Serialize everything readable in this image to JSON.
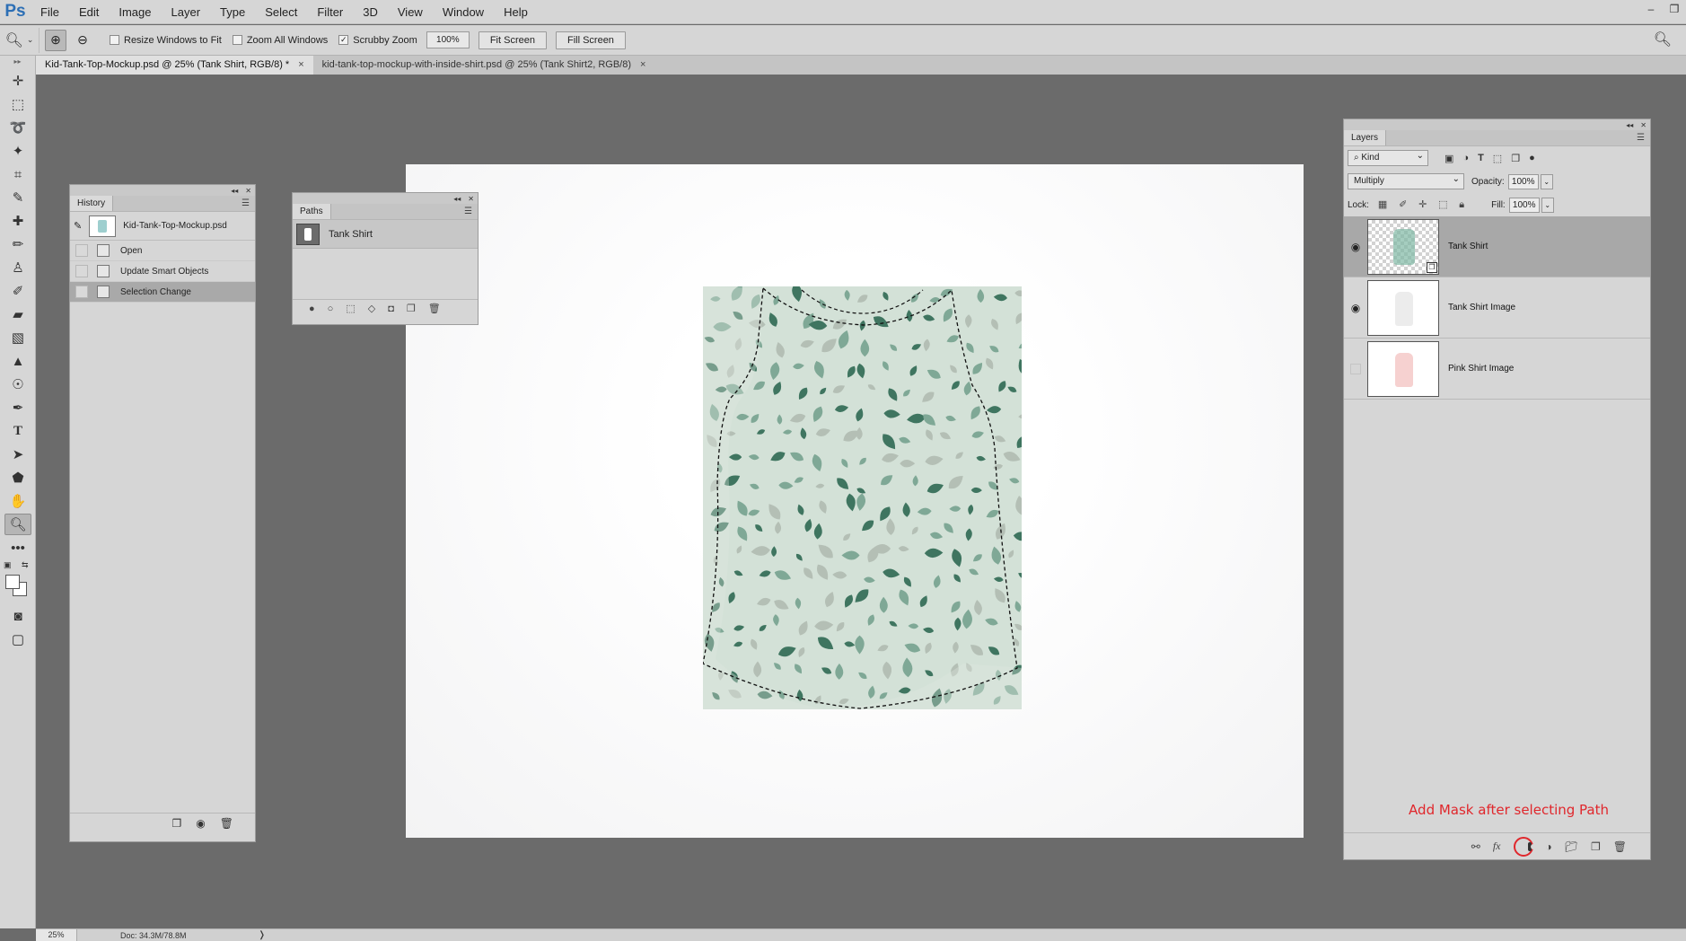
{
  "app": {
    "logo": "Ps",
    "window_controls": [
      "–",
      "❐"
    ]
  },
  "menu": [
    "File",
    "Edit",
    "Image",
    "Layer",
    "Type",
    "Select",
    "Filter",
    "3D",
    "View",
    "Window",
    "Help"
  ],
  "options": {
    "tool_icon": "zoom-tool-icon",
    "resize_windows": "Resize Windows to Fit",
    "zoom_all": "Zoom All Windows",
    "scrubby": "Scrubby Zoom",
    "scrubby_checked": "✓",
    "zoom_value": "100%",
    "fit_screen": "Fit Screen",
    "fill_screen": "Fill Screen"
  },
  "tabs": [
    {
      "label": "Kid-Tank-Top-Mockup.psd @ 25% (Tank Shirt, RGB/8) *",
      "close": "×"
    },
    {
      "label": "kid-tank-top-mockup-with-inside-shirt.psd @ 25% (Tank Shirt2, RGB/8)",
      "close": "×"
    }
  ],
  "history": {
    "title": "History",
    "snapshot": "Kid-Tank-Top-Mockup.psd",
    "items": [
      "Open",
      "Update Smart Objects",
      "Selection Change"
    ],
    "selected_index": 2
  },
  "paths": {
    "title": "Paths",
    "items": [
      "Tank Shirt"
    ]
  },
  "layers": {
    "title": "Layers",
    "kind": "Kind",
    "blend_mode": "Multiply",
    "opacity_label": "Opacity:",
    "opacity": "100%",
    "lock_label": "Lock:",
    "fill_label": "Fill:",
    "fill": "100%",
    "items": [
      {
        "name": "Tank Shirt",
        "visible": true,
        "selected": true
      },
      {
        "name": "Tank Shirt Image",
        "visible": true,
        "selected": false
      },
      {
        "name": "Pink Shirt Image",
        "visible": false,
        "selected": false
      }
    ],
    "annotation": "Add Mask after selecting Path"
  },
  "status": {
    "zoom": "25%",
    "doc": "Doc: 34.3M/78.8M",
    "arrow": "❭"
  },
  "colors": {
    "accent_red": "#e0272c",
    "shirt_base": "#d3e1d7",
    "leaf_dark": "#3f7560",
    "leaf_mid": "#7fa896",
    "leaf_light": "#b4bfb5"
  }
}
